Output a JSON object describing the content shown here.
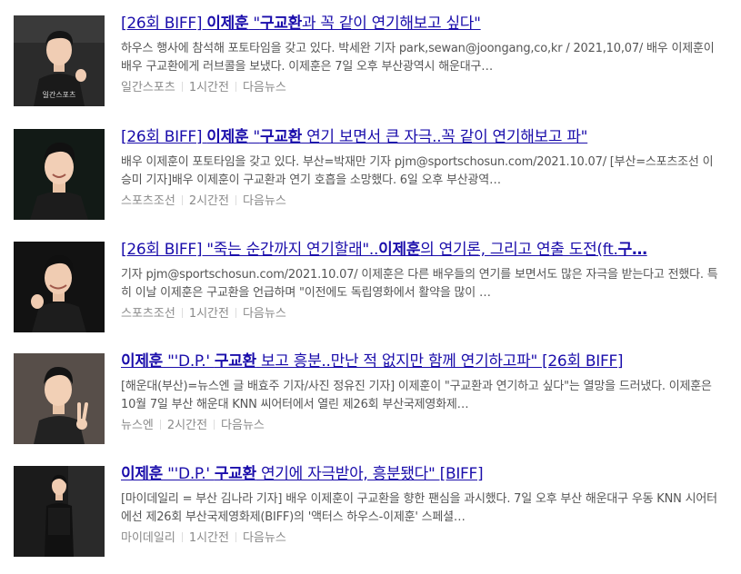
{
  "results": [
    {
      "title_pre": "[26회 BIFF] ",
      "title_name": "이제훈",
      "title_mid": " \"",
      "title_kw": "구교환",
      "title_post": "과 꼭 같이 연기해보고 싶다\"",
      "desc": "하우스 행사에 참석해 포토타임을 갖고 있다. 박세완 기자 park,sewan@joongang,co,kr / 2021,10,07/ 배우 이제훈이 배우 구교환에게 러브콜을 보냈다. 이제훈은 7일 오후 부산광역시 해운대구…",
      "source": "일간스포츠",
      "time": "1시간전",
      "link": "다음뉴스",
      "thumb_caption": "일간스포츠"
    },
    {
      "title_pre": "[26회 BIFF] ",
      "title_name": "이제훈",
      "title_mid": " \"",
      "title_kw": "구교환",
      "title_post": " 연기 보면서 큰 자극..꼭 같이 연기해보고 파\"",
      "desc": "배우 이제훈이 포토타임을 갖고 있다. 부산=박재만 기자 pjm@sportschosun.com/2021.10.07/ [부산=스포츠조선 이승미 기자]배우 이제훈이 구교환과 연기 호흡을 소망했다. 6일 오후 부산광역…",
      "source": "스포츠조선",
      "time": "2시간전",
      "link": "다음뉴스",
      "thumb_caption": ""
    },
    {
      "title_pre": "[26회 BIFF] \"죽는 순간까지 연기할래\"..",
      "title_name": "이제훈",
      "title_mid": "의 연기론, 그리고 연출 도전(ft.",
      "title_kw": "구…",
      "title_post": "",
      "desc": "기자 pjm@sportschosun.com/2021.10.07/ 이제훈은 다른 배우들의 연기를 보면서도 많은 자극을 받는다고 전했다. 특히 이날 이제훈은 구교환을 언급하며 \"이전에도 독립영화에서 활약을 많이 …",
      "source": "스포츠조선",
      "time": "1시간전",
      "link": "다음뉴스",
      "thumb_caption": ""
    },
    {
      "title_pre": "",
      "title_name": "이제훈",
      "title_mid": " \"'D.P.' ",
      "title_kw": "구교환",
      "title_post": " 보고 흥분..만난 적 없지만 함께 연기하고파\" [26회 BIFF]",
      "desc": "[해운대(부산)=뉴스엔 글 배효주 기자/사진 정유진 기자] 이제훈이 \"구교환과 연기하고 싶다\"는 열망을 드러냈다. 이제훈은 10월 7일 부산 해운대 KNN 씨어터에서 열린 제26회 부산국제영화제…",
      "source": "뉴스엔",
      "time": "2시간전",
      "link": "다음뉴스",
      "thumb_caption": ""
    },
    {
      "title_pre": "",
      "title_name": "이제훈",
      "title_mid": " \"'D.P.' ",
      "title_kw": "구교환",
      "title_post": " 연기에 자극받아, 흥분됐다\" [BIFF]",
      "desc": "[마이데일리 = 부산 김나라 기자] 배우 이제훈이 구교환을 향한 팬심을 과시했다. 7일 오후 부산 해운대구 우동 KNN 시어터에선 제26회 부산국제영화제(BIFF)의 '액터스 하우스-이제훈' 스페셜…",
      "source": "마이데일리",
      "time": "1시간전",
      "link": "다음뉴스",
      "thumb_caption": ""
    }
  ],
  "colors": {
    "title": "#1a0dab",
    "desc": "#555555",
    "meta": "#8a8a8a"
  }
}
